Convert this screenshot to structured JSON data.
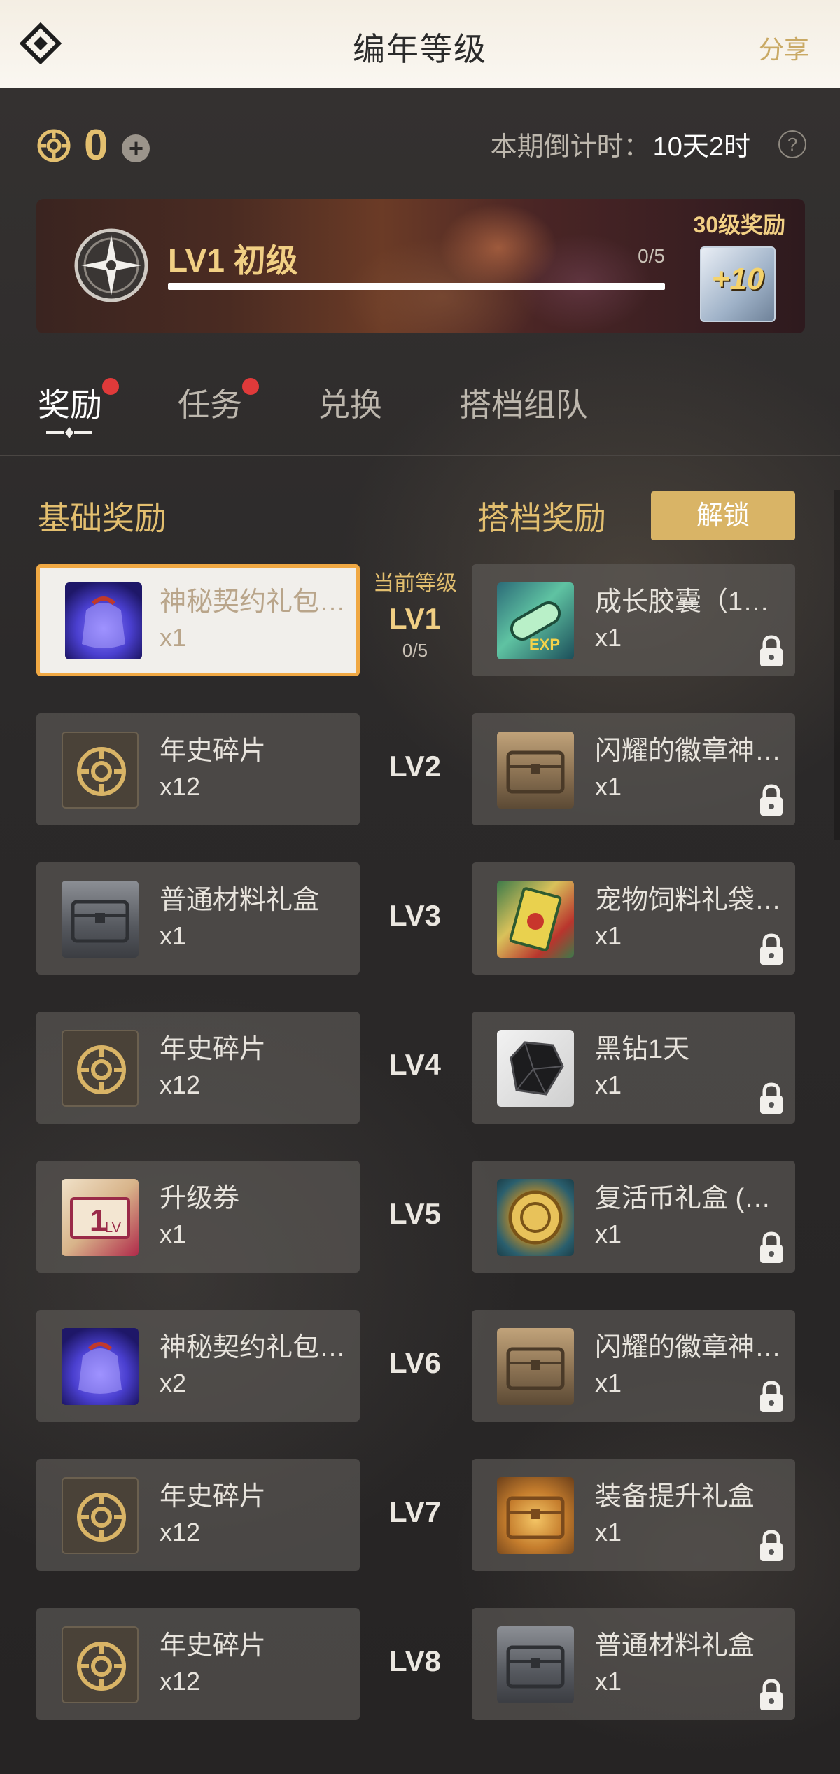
{
  "header": {
    "title": "编年等级",
    "share_label": "分享"
  },
  "points": {
    "value": "0",
    "add_symbol": "+"
  },
  "countdown": {
    "label": "本期倒计时：",
    "value": "10天2时",
    "help_symbol": "?"
  },
  "banner": {
    "level_label": "LV1 初级",
    "progress_text": "0/5",
    "progress_fraction": 0,
    "reward_label": "30级奖励",
    "reward_item_text": "+10"
  },
  "tabs": [
    {
      "label": "奖励",
      "active": true,
      "dot": true
    },
    {
      "label": "任务",
      "active": false,
      "dot": true
    },
    {
      "label": "兑换",
      "active": false,
      "dot": false
    },
    {
      "label": "搭档组队",
      "active": false,
      "dot": false
    }
  ],
  "sections": {
    "basic": "基础奖励",
    "partner": "搭档奖励",
    "unlock_label": "解锁"
  },
  "current_level": {
    "caption": "当前等级",
    "progress": "0/5"
  },
  "rows": [
    {
      "level": "LV1",
      "current": true,
      "basic": {
        "name": "神秘契约礼包 …",
        "qty": "x1",
        "icon": "mystery-pack"
      },
      "partner": {
        "name": "成长胶囊（10…",
        "qty": "x1",
        "icon": "growth-capsule"
      }
    },
    {
      "level": "LV2",
      "basic": {
        "name": "年史碎片",
        "qty": "x12",
        "icon": "chronicle-coin"
      },
      "partner": {
        "name": "闪耀的徽章神…",
        "qty": "x1",
        "icon": "badge-chest"
      }
    },
    {
      "level": "LV3",
      "basic": {
        "name": "普通材料礼盒",
        "qty": "x1",
        "icon": "material-chest"
      },
      "partner": {
        "name": "宠物饲料礼袋 …",
        "qty": "x1",
        "icon": "pet-food"
      }
    },
    {
      "level": "LV4",
      "basic": {
        "name": "年史碎片",
        "qty": "x12",
        "icon": "chronicle-coin"
      },
      "partner": {
        "name": "黑钻1天",
        "qty": "x1",
        "icon": "black-diamond"
      }
    },
    {
      "level": "LV5",
      "basic": {
        "name": "升级券",
        "qty": "x1",
        "icon": "level-ticket"
      },
      "partner": {
        "name": "复活币礼盒 (1…",
        "qty": "x1",
        "icon": "revive-coin"
      }
    },
    {
      "level": "LV6",
      "basic": {
        "name": "神秘契约礼包 …",
        "qty": "x2",
        "icon": "mystery-pack"
      },
      "partner": {
        "name": "闪耀的徽章神…",
        "qty": "x1",
        "icon": "badge-chest"
      }
    },
    {
      "level": "LV7",
      "basic": {
        "name": "年史碎片",
        "qty": "x12",
        "icon": "chronicle-coin"
      },
      "partner": {
        "name": "装备提升礼盒",
        "qty": "x1",
        "icon": "equip-box"
      }
    },
    {
      "level": "LV8",
      "basic": {
        "name": "年史碎片",
        "qty": "x12",
        "icon": "chronicle-coin"
      },
      "partner": {
        "name": "普通材料礼盒",
        "qty": "x1",
        "icon": "material-chest"
      }
    }
  ],
  "colors": {
    "accent_gold": "#e3bf6f",
    "current_border": "#f0a843",
    "notify_dot": "#e03a3a"
  }
}
